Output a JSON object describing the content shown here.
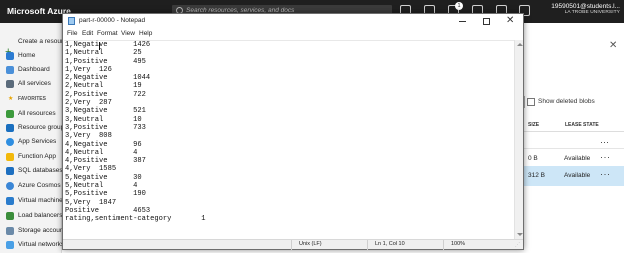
{
  "azure": {
    "brand": "Microsoft Azure",
    "search_placeholder": "Search resources, services, and docs",
    "notification_count": "1",
    "account": {
      "username": "19590501@students.l...",
      "organization": "LA TROBE UNIVERSITY"
    },
    "sidebar": {
      "create": "Create a resource",
      "home": "Home",
      "dashboard": "Dashboard",
      "all_services": "All services",
      "favorites": "FAVORITES",
      "items": [
        "All resources",
        "Resource groups",
        "App Services",
        "Function App",
        "SQL databases",
        "Azure Cosmos DB",
        "Virtual machines",
        "Load balancers",
        "Storage accounts",
        "Virtual networks"
      ]
    },
    "blobs": {
      "show_deleted": "Show deleted blobs",
      "col_size": "SIZE",
      "col_lease": "LEASE STATE",
      "rows": [
        {
          "size": "0 B",
          "lease": "Available"
        },
        {
          "size": "312 B",
          "lease": "Available"
        }
      ]
    },
    "colors": {
      "topbar": "#1f1f1f",
      "selected_row": "#cde6f7",
      "accent": "#0078d4"
    }
  },
  "notepad": {
    "title": "part-r-00000 - Notepad",
    "menu": [
      "File",
      "Edit",
      "Format",
      "View",
      "Help"
    ],
    "lines": [
      "1,Negative      1426",
      "1,Neutral       25",
      "1,Positive      495",
      "1,Very  126",
      "2,Negative      1044",
      "2,Neutral       19",
      "2,Positive      722",
      "2,Very  287",
      "3,Negative      521",
      "3,Neutral       10",
      "3,Positive      733",
      "3,Very  808",
      "4,Negative      96",
      "4,Neutral       4",
      "4,Positive      387",
      "4,Very  1585",
      "5,Negative      30",
      "5,Neutral       4",
      "5,Positive      190",
      "5,Very  1847",
      "Positive        4653",
      "rating,sentiment-category       1"
    ],
    "status": {
      "line_ending": "Unix (LF)",
      "position": "Ln 1, Col 10",
      "zoom": "100%"
    }
  }
}
